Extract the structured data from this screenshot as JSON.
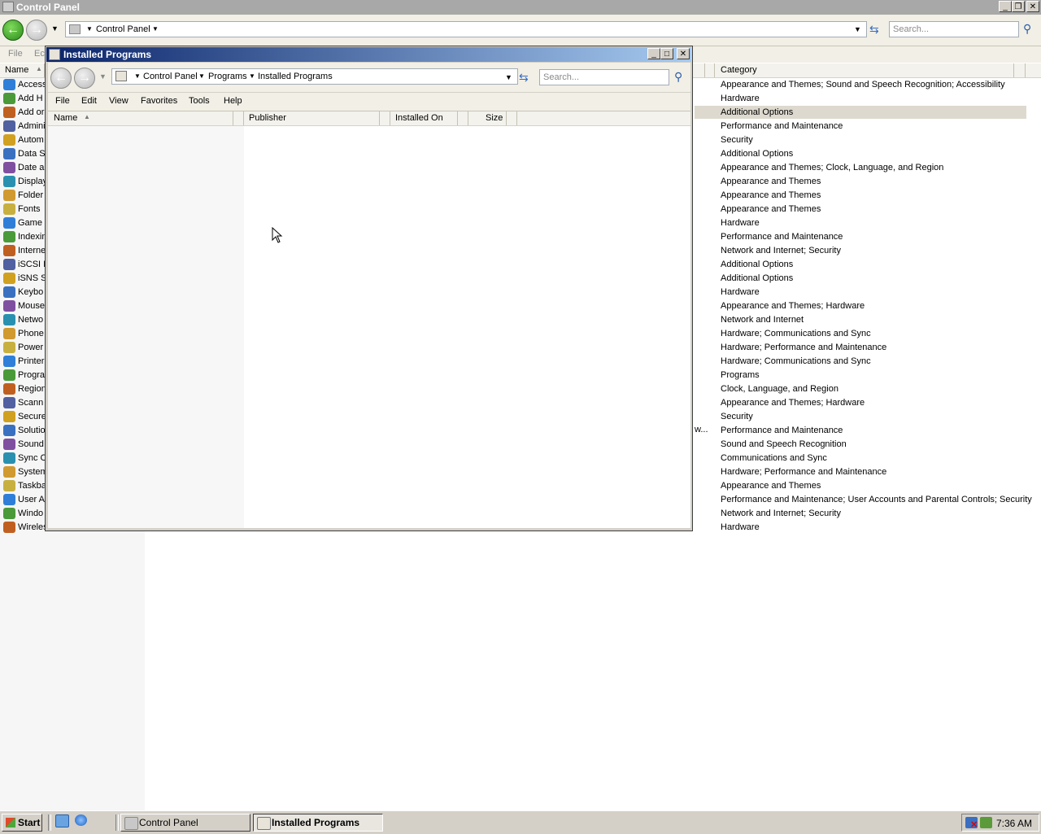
{
  "control_panel": {
    "title": "Control Panel",
    "address": "Control Panel",
    "search_placeholder": "Search...",
    "menu": [
      "File",
      "Ec"
    ],
    "header": {
      "name": "Name",
      "category": "Category"
    },
    "items": [
      "Access",
      "Add H",
      "Add or",
      "Admini",
      "Autom",
      "Data S",
      "Date a",
      "Display",
      "Folder",
      "Fonts",
      "Game",
      "Indexin",
      "Interne",
      "iSCSI I",
      "iSNS S",
      "Keybo",
      "Mouse",
      "Netwo",
      "Phone",
      "Power",
      "Printer",
      "Progra",
      "Region",
      "Scann",
      "Secure",
      "Solutio",
      "Sound",
      "Sync C",
      "System",
      "Taskba",
      "User A",
      "Windo",
      "Wireles"
    ],
    "categories": [
      "Appearance and Themes; Sound and Speech Recognition; Accessibility",
      "Hardware",
      "Additional Options",
      "Performance and Maintenance",
      "Security",
      "Additional Options",
      "Appearance and Themes; Clock, Language, and Region",
      "Appearance and Themes",
      "Appearance and Themes",
      "Appearance and Themes",
      "Hardware",
      "Performance and Maintenance",
      "Network and Internet; Security",
      "Additional Options",
      "Additional Options",
      "Hardware",
      "Appearance and Themes; Hardware",
      "Network and Internet",
      "Hardware; Communications and Sync",
      "Hardware; Performance and Maintenance",
      "Hardware; Communications and Sync",
      "Programs",
      "Clock, Language, and Region",
      "Appearance and Themes; Hardware",
      "Security",
      "Performance and Maintenance",
      "Sound and Speech Recognition",
      "Communications and Sync",
      "Hardware; Performance and Maintenance",
      "Appearance and Themes",
      "Performance and Maintenance; User Accounts and Parental Controls; Security",
      "Network and Internet; Security",
      "Hardware"
    ],
    "truncated_desc": "w..."
  },
  "installed_programs": {
    "title": "Installed Programs",
    "breadcrumb": [
      "Control Panel",
      "Programs",
      "Installed Programs"
    ],
    "search_placeholder": "Search...",
    "menu": [
      "File",
      "Edit",
      "View",
      "Favorites",
      "Tools",
      "Help"
    ],
    "columns": [
      "Name",
      "Publisher",
      "Installed On",
      "Size"
    ]
  },
  "taskbar": {
    "start": "Start",
    "tasks": [
      "Control Panel",
      "Installed Programs"
    ],
    "clock": "7:36 AM"
  },
  "colors": {
    "title_active": "#0a246a",
    "title_inactive": "#a8a8a8",
    "selection": "#ddd9cf"
  }
}
